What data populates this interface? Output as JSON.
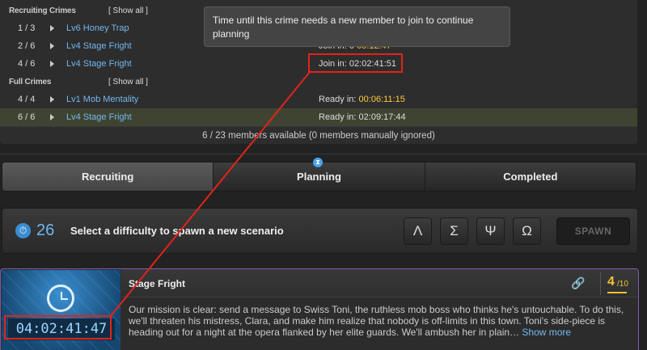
{
  "recruiting": {
    "title": "Recruiting Crimes",
    "show_all": "[ Show all ]",
    "rows": [
      {
        "count": "1 / 3",
        "name": "Lv6 Honey Trap",
        "status_label": "",
        "status_time": ""
      },
      {
        "count": "2 / 6",
        "name": "Lv4 Stage Fright",
        "status_label": "Join in: 0",
        "status_time": "05:12:47"
      },
      {
        "count": "4 / 6",
        "name": "Lv4 Stage Fright",
        "status_label": "Join in:",
        "status_time": "02:02:41:51"
      }
    ]
  },
  "full": {
    "title": "Full Crimes",
    "show_all": "[ Show all ]",
    "rows": [
      {
        "count": "4 / 4",
        "name": "Lv1 Mob Mentality",
        "status_label": "Ready in:",
        "status_time": "00:06:11:15"
      },
      {
        "count": "6 / 6",
        "name": "Lv4 Stage Fright",
        "status_label": "Ready in:",
        "status_time": "02:09:17:44"
      }
    ]
  },
  "member_summary": "6 / 23 members available (0 members manually ignored)",
  "tabs": [
    {
      "label": "Recruiting"
    },
    {
      "label": "Planning"
    },
    {
      "label": "Completed"
    }
  ],
  "spawn": {
    "count": "26",
    "text": "Select a difficulty to spawn a new scenario",
    "difficulties": [
      "Λ",
      "Σ",
      "Ψ",
      "Ω"
    ],
    "button": "SPAWN"
  },
  "scenario": {
    "title": "Stage Fright",
    "timer": "04:02:41:47",
    "level": "4",
    "level_max": "/10",
    "description": "Our mission is clear: send a message to Swiss Toni, the ruthless mob boss who thinks he's untouchable. To do this, we'll threaten his mistress, Clara, and make him realize that nobody is off-limits in this town. Toni's side-piece is heading out for a night at the opera flanked by her elite guards. We'll ambush her in plain…",
    "show_more": "Show more"
  },
  "tooltip": "Time until this crime needs a new member to join to continue planning",
  "colors": {
    "accent_blue": "#74b7ee",
    "timer_yellow": "#ffcc3a",
    "annotation_red": "#e2231a",
    "card_border": "#7a5bb2"
  },
  "icons": {
    "spawn": "stopwatch-icon",
    "tab_badge": "hourglass-icon",
    "link": "link-icon",
    "card_image": "clock-icon"
  }
}
